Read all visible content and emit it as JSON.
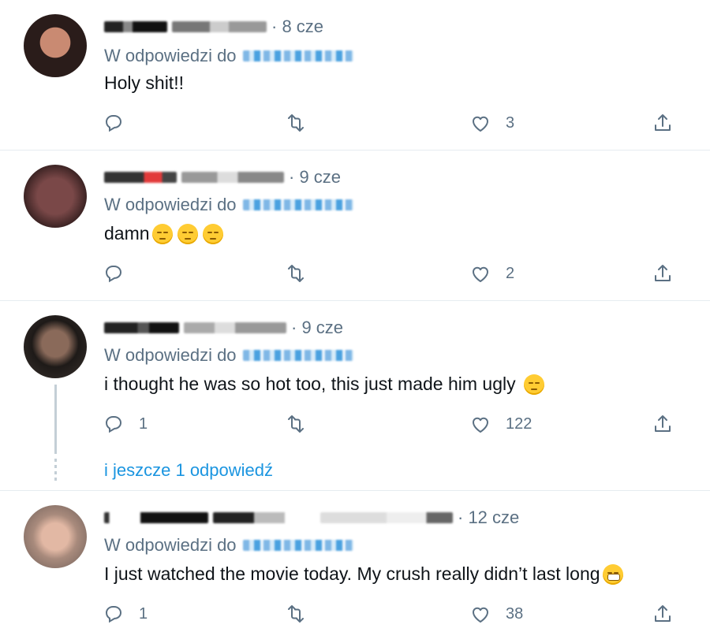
{
  "tweets": [
    {
      "time": "· 8 cze",
      "reply_prefix": "W odpowiedzi do",
      "text": "Holy shit!!",
      "emoji": [],
      "reply_count": "",
      "like_count": "3"
    },
    {
      "time": "· 9 cze",
      "reply_prefix": "W odpowiedzi do",
      "text": "damn",
      "emoji": [
        "pensive-face",
        "pensive-face",
        "pensive-face"
      ],
      "reply_count": "",
      "like_count": "2"
    },
    {
      "time": "· 9 cze",
      "reply_prefix": "W odpowiedzi do",
      "text": "i thought he was so hot too, this just made him ugly",
      "emoji": [
        "woozy-face"
      ],
      "reply_count": "1",
      "like_count": "122"
    },
    {
      "time": "· 12 cze",
      "reply_prefix": "W odpowiedzi do",
      "text": "I just watched the movie today. My crush really didn’t last long",
      "emoji": [
        "grimacing-face"
      ],
      "reply_count": "1",
      "like_count": "38"
    }
  ],
  "more_replies": "i jeszcze 1 odpowiedź",
  "icons": {
    "reply": "reply-icon",
    "retweet": "retweet-icon",
    "like": "heart-icon",
    "share": "share-icon"
  },
  "colors": {
    "secondary_text": "#5b7083",
    "link": "#1b95e0",
    "separator": "#e6ecf0"
  }
}
